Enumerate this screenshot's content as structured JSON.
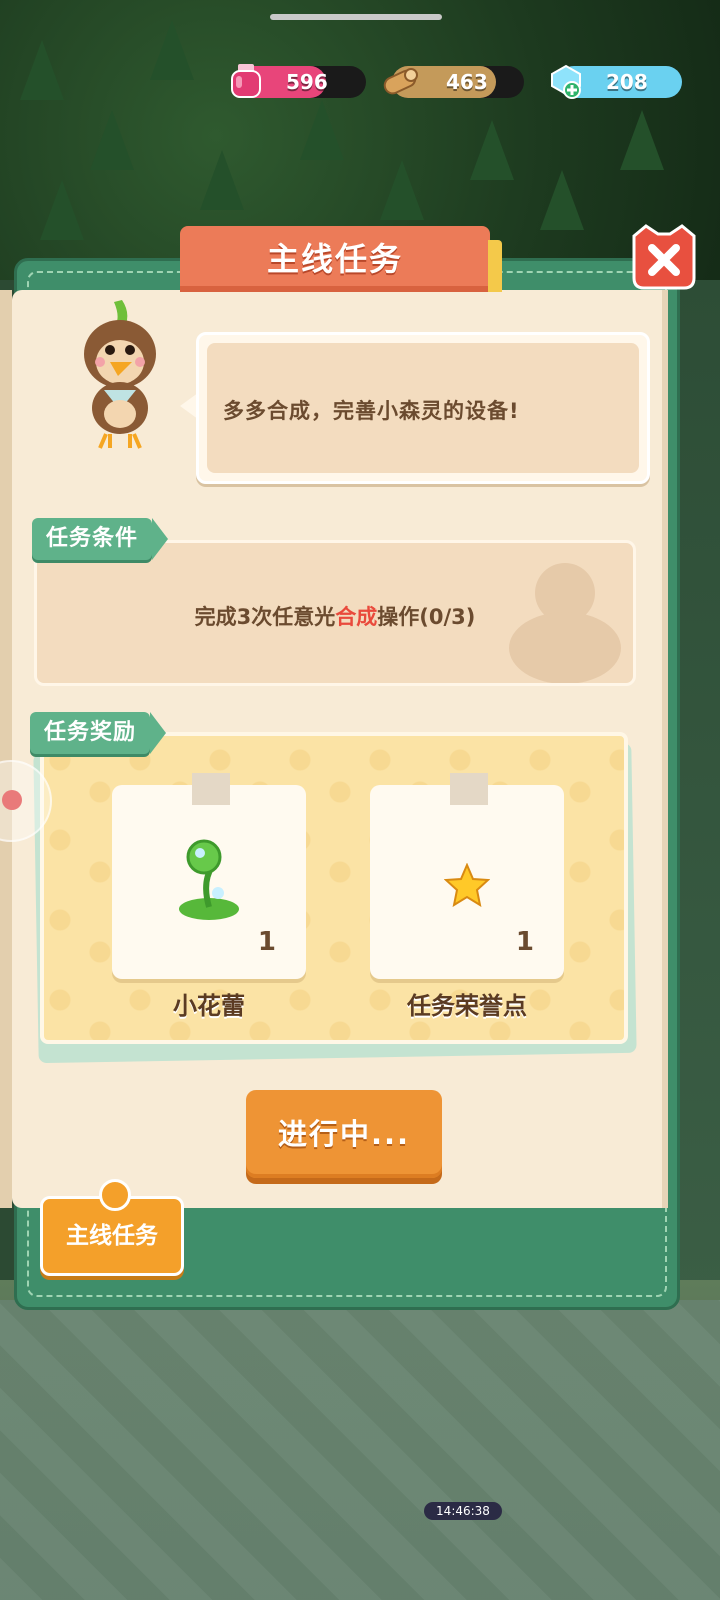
{
  "resources": {
    "potion": {
      "value": "596",
      "icon": "pink-potion-icon",
      "color": "#e8457a"
    },
    "wood": {
      "value": "463",
      "icon": "wood-log-icon",
      "color": "#c49a5a"
    },
    "gem": {
      "value": "208",
      "icon": "blue-gem-plus-icon",
      "color": "#6ad1f0"
    }
  },
  "dialog": {
    "title": "主线任务",
    "speech": "多多合成，完善小森灵的设备!",
    "condition_label": "任务条件",
    "condition_text_prefix": "完成3次任意光",
    "condition_text_highlight": "合成",
    "condition_text_suffix": "操作(0/3)",
    "reward_label": "任务奖励",
    "rewards": [
      {
        "name": "小花蕾",
        "count": "1",
        "icon": "flower-bud-icon"
      },
      {
        "name": "任务荣誉点",
        "count": "1",
        "icon": "star-icon"
      }
    ],
    "action_button": "进行中...",
    "side_tab": "主线任务"
  },
  "status": {
    "clock": "14:46:38"
  },
  "colors": {
    "accent": "#ec7b58",
    "panel": "#3f8e6a",
    "button": "#ee9435",
    "highlight": "#e94a3c"
  }
}
